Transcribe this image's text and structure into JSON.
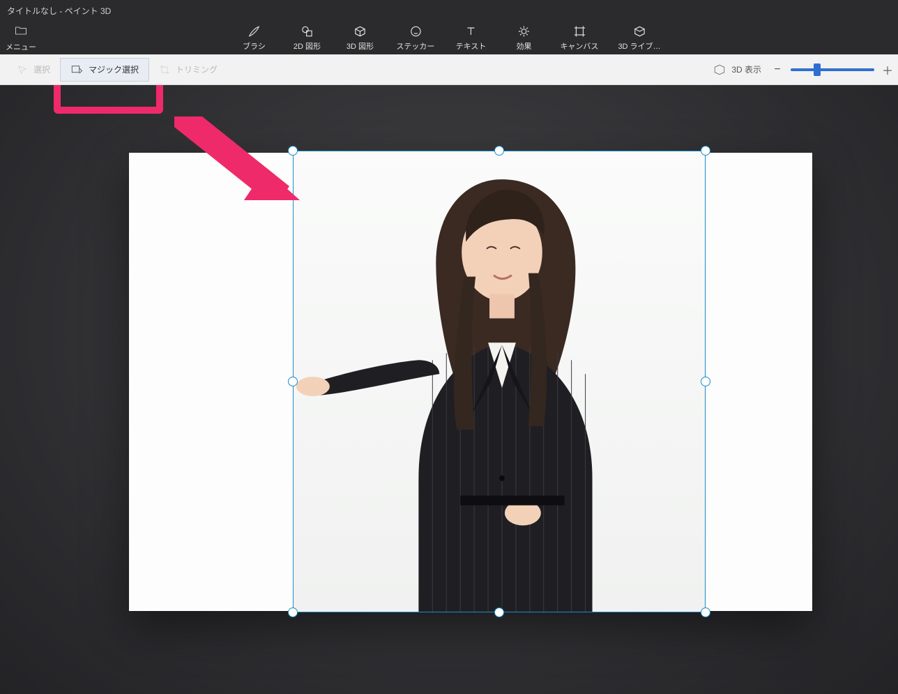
{
  "window": {
    "title": "タイトルなし - ペイント 3D"
  },
  "menu": {
    "label": "メニュー"
  },
  "ribbon": {
    "tools": [
      {
        "id": "brush",
        "label": "ブラシ"
      },
      {
        "id": "shapes2d",
        "label": "2D 図形"
      },
      {
        "id": "shapes3d",
        "label": "3D 図形"
      },
      {
        "id": "sticker",
        "label": "ステッカー"
      },
      {
        "id": "text",
        "label": "テキスト"
      },
      {
        "id": "effects",
        "label": "効果"
      },
      {
        "id": "canvas",
        "label": "キャンバス"
      },
      {
        "id": "library",
        "label": "3D ライブ…"
      }
    ]
  },
  "subbar": {
    "select": "選択",
    "magicselect": "マジック選択",
    "crop": "トリミング",
    "view3d": "3D 表示"
  },
  "zoom": {
    "minus": "−",
    "plus": "＋",
    "value_percent": 32
  },
  "annotation": {
    "highlight_color": "#ee2a6b",
    "target": "magic-select-button"
  },
  "canvas": {
    "content_description": "woman-in-black-suit-gesturing-left",
    "selection_active": true
  }
}
